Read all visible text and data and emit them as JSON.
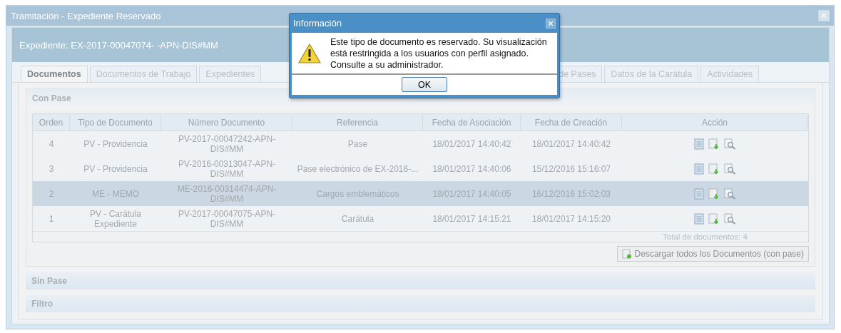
{
  "window": {
    "title": "Tramitación - Expediente Reservado"
  },
  "header": {
    "title": "Expediente: EX-2017-00047074- -APN-DIS#MM"
  },
  "tabs": [
    {
      "label": "Documentos",
      "selected": true
    },
    {
      "label": "Documentos de Trabajo",
      "selected": false
    },
    {
      "label": "Expedientes",
      "selected": false
    },
    {
      "label": "de Pases",
      "selected": false
    },
    {
      "label": "Datos de la Carátula",
      "selected": false
    },
    {
      "label": "Actividades",
      "selected": false
    }
  ],
  "sections": [
    {
      "title": "Con Pase",
      "expanded": true
    },
    {
      "title": "Sin Pase",
      "expanded": false
    },
    {
      "title": "Filtro",
      "expanded": false
    }
  ],
  "table": {
    "columns": [
      "Orden",
      "Tipo de Documento",
      "Número Documento",
      "Referencia",
      "Fecha de Asociación",
      "Fecha de Creación",
      "Acción"
    ],
    "rows": [
      {
        "cells": [
          "4",
          "PV - Providencia",
          "PV-2017-00047242-APN-DIS#MM",
          "Pase",
          "18/01/2017 14:40:42",
          "18/01/2017 14:40:42"
        ],
        "selected": false
      },
      {
        "cells": [
          "3",
          "PV - Providencia",
          "PV-2016-00313047-APN-DIS#MM",
          "Pase electrónico de EX-2016-...",
          "18/01/2017 14:40:06",
          "15/12/2016 15:16:07"
        ],
        "selected": false
      },
      {
        "cells": [
          "2",
          "ME - MEMO",
          "ME-2016-00314474-APN-DIS#MM",
          "Cargos emblemáticos",
          "18/01/2017 14:40:05",
          "16/12/2016 15:02:03"
        ],
        "selected": true
      },
      {
        "cells": [
          "1",
          "PV - Carátula Expediente",
          "PV-2017-00047075-APN-DIS#MM",
          "Carátula",
          "18/01/2017 14:15:21",
          "18/01/2017 14:15:20"
        ],
        "selected": false
      }
    ],
    "total": "Total de documentos: 4"
  },
  "download_button": {
    "label": "Descargar todos los Documentos (con pase)"
  },
  "dialog": {
    "title": "Información",
    "message": "Este tipo de documento es reservado. Su visualización está restringida a los usuarios con perfil asignado. Consulte a su administrador.",
    "button": "OK"
  }
}
